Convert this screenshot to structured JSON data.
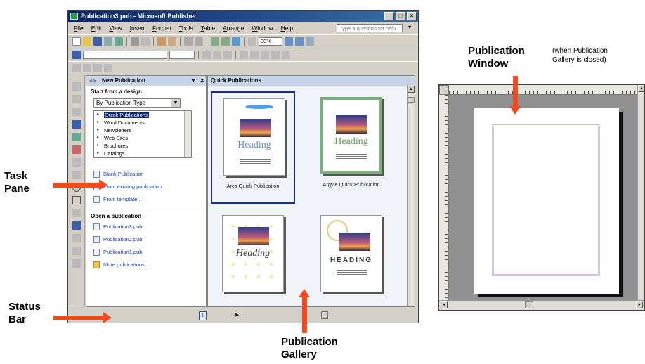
{
  "window": {
    "title": "Publication3.pub - Microsoft Publisher",
    "controls": [
      "_",
      "□",
      "×"
    ]
  },
  "menu": [
    "File",
    "Edit",
    "View",
    "Insert",
    "Format",
    "Tools",
    "Table",
    "Arrange",
    "Window",
    "Help"
  ],
  "help_placeholder": "Type a question for help",
  "zoom": "30%",
  "task_pane": {
    "title": "New Publication",
    "close": "×",
    "start_section": "Start from a design",
    "design_select": "By Publication Type",
    "design_list": [
      "Quick Publications",
      "Word Documents",
      "Newsletters",
      "Web Sites",
      "Brochures",
      "Catalogs"
    ],
    "new_links": [
      "Blank Publication",
      "From existing publication...",
      "From template..."
    ],
    "open_section": "Open a publication",
    "open_links": [
      "Publication3.pub",
      "Publication2.pub",
      "Publication1.pub",
      "More publications..."
    ]
  },
  "gallery": {
    "title": "Quick Publications",
    "thumbs": [
      {
        "label": "Arcs Quick Publication",
        "heading": "Heading",
        "selected": true
      },
      {
        "label": "Argyle Quick Publication",
        "heading": "Heading",
        "selected": false
      },
      {
        "label": "",
        "heading": "Heading",
        "selected": false
      },
      {
        "label": "",
        "heading": "HEADING",
        "selected": false
      }
    ]
  },
  "status_bar": {
    "page": "1"
  },
  "annotations": {
    "task_pane": [
      "Task",
      "Pane"
    ],
    "status_bar": [
      "Status",
      "Bar"
    ],
    "gallery": [
      "Publication",
      "Gallery"
    ],
    "pub_window": [
      "Publication",
      "Window"
    ],
    "pub_window_note": [
      "(when Publication",
      "Gallery is closed)"
    ]
  },
  "colors": {
    "arrow": "#f04a1e",
    "titlebar": "#0a246a"
  }
}
